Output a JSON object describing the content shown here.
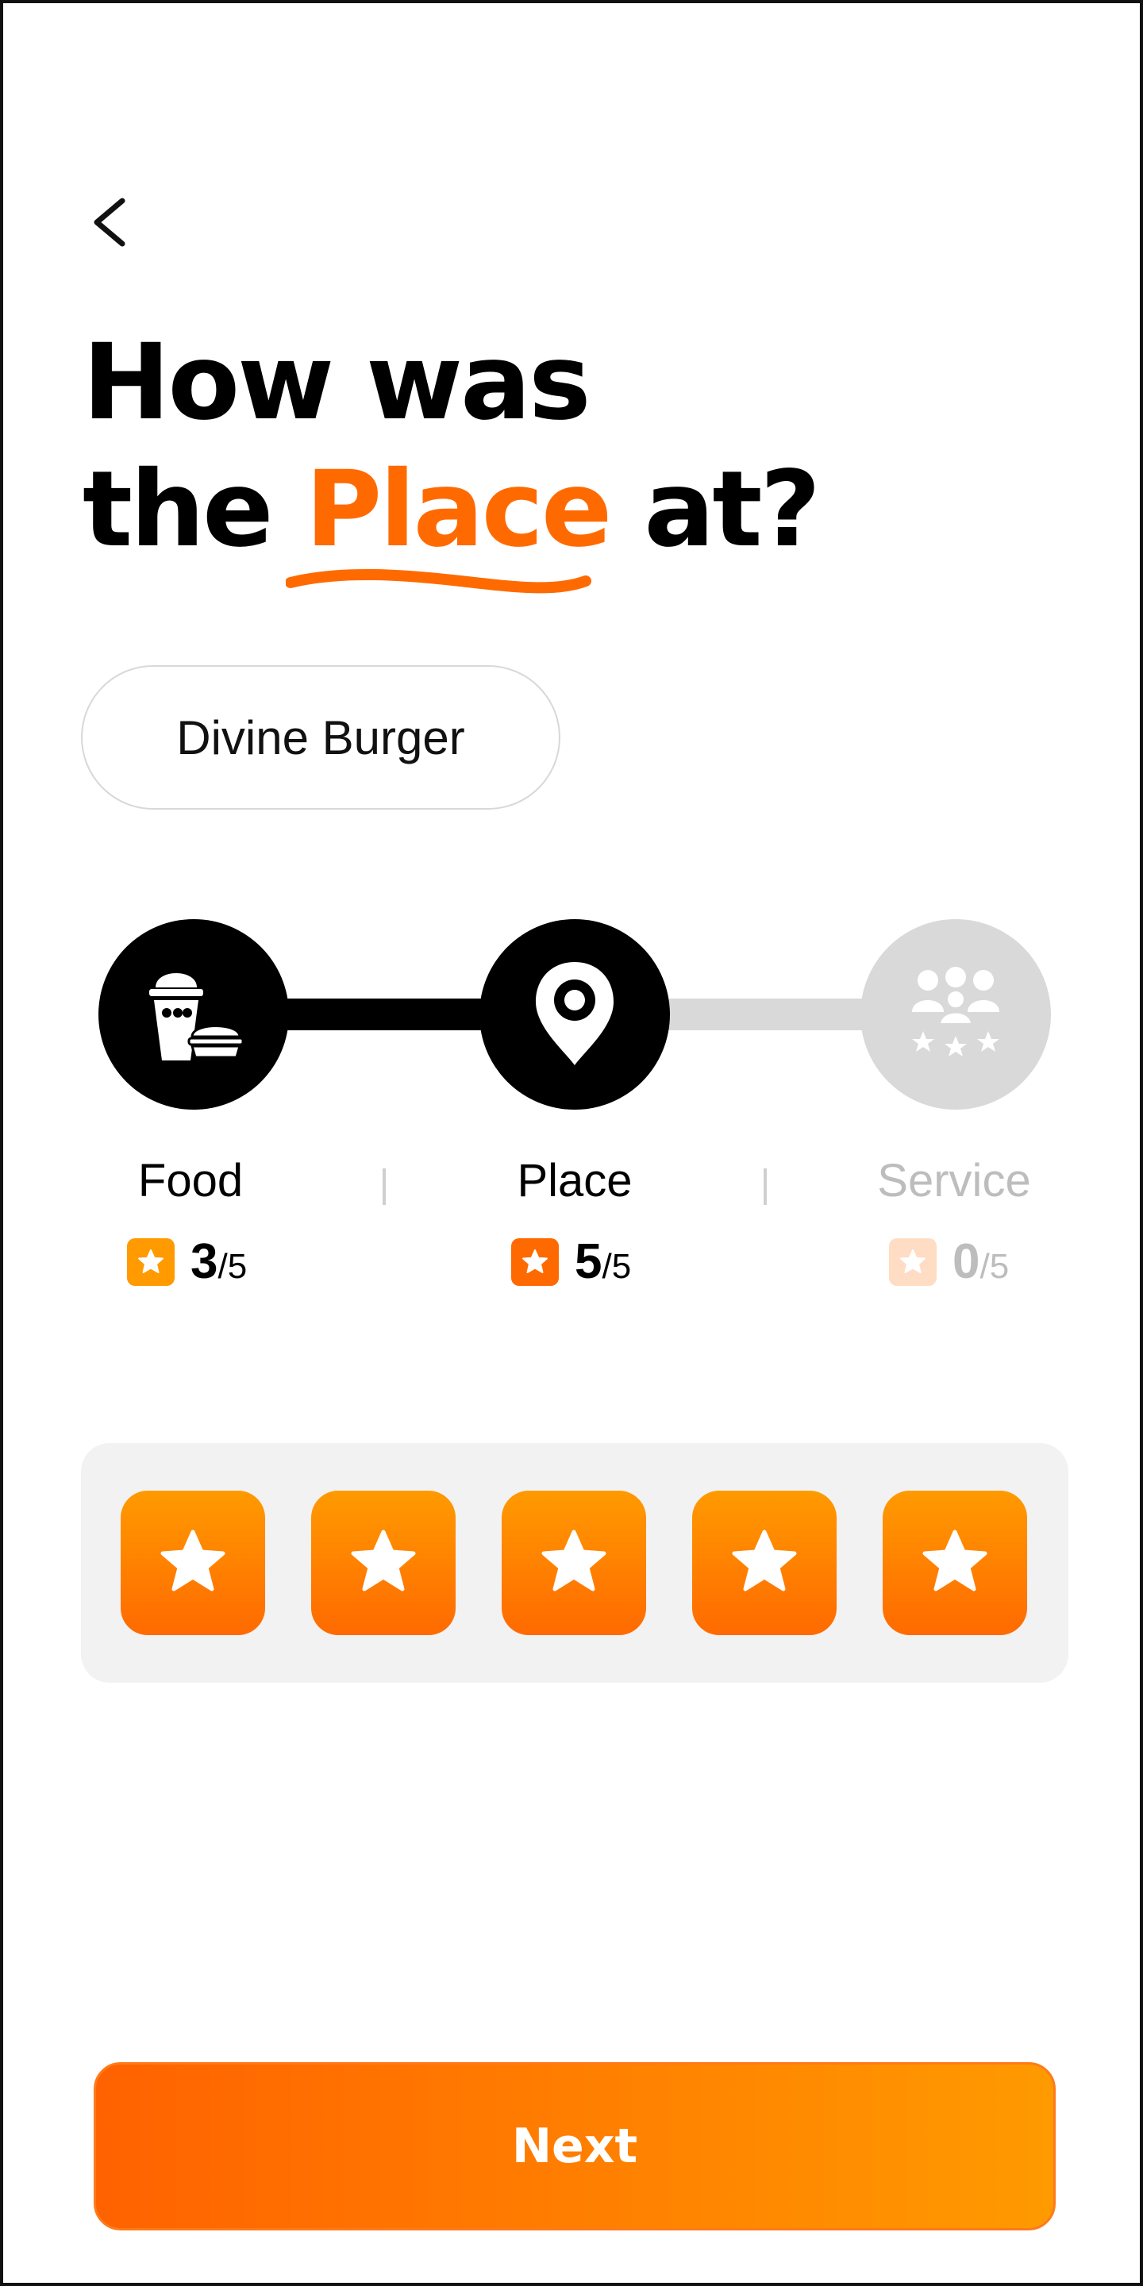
{
  "header": {
    "back_icon": "chevron-left-icon"
  },
  "title": {
    "line1": "How was",
    "line2_prefix": "the ",
    "line2_accent": "Place",
    "line2_suffix": " at?"
  },
  "restaurant": {
    "name": "Divine Burger"
  },
  "steps": [
    {
      "label": "Food",
      "icon": "food-combo-icon",
      "score": "3",
      "max": "/5",
      "state": "completed"
    },
    {
      "label": "Place",
      "icon": "location-pin-icon",
      "score": "5",
      "max": "/5",
      "state": "active"
    },
    {
      "label": "Service",
      "icon": "people-rating-icon",
      "score": "0",
      "max": "/5",
      "state": "pending"
    }
  ],
  "rating": {
    "selected": 5,
    "max": 5,
    "icon": "star-icon"
  },
  "footer": {
    "next_label": "Next"
  },
  "colors": {
    "accent": "#ff6a00",
    "accent_light": "#ff9a00",
    "inactive": "#d9d9d9",
    "panel": "#f2f2f2"
  }
}
